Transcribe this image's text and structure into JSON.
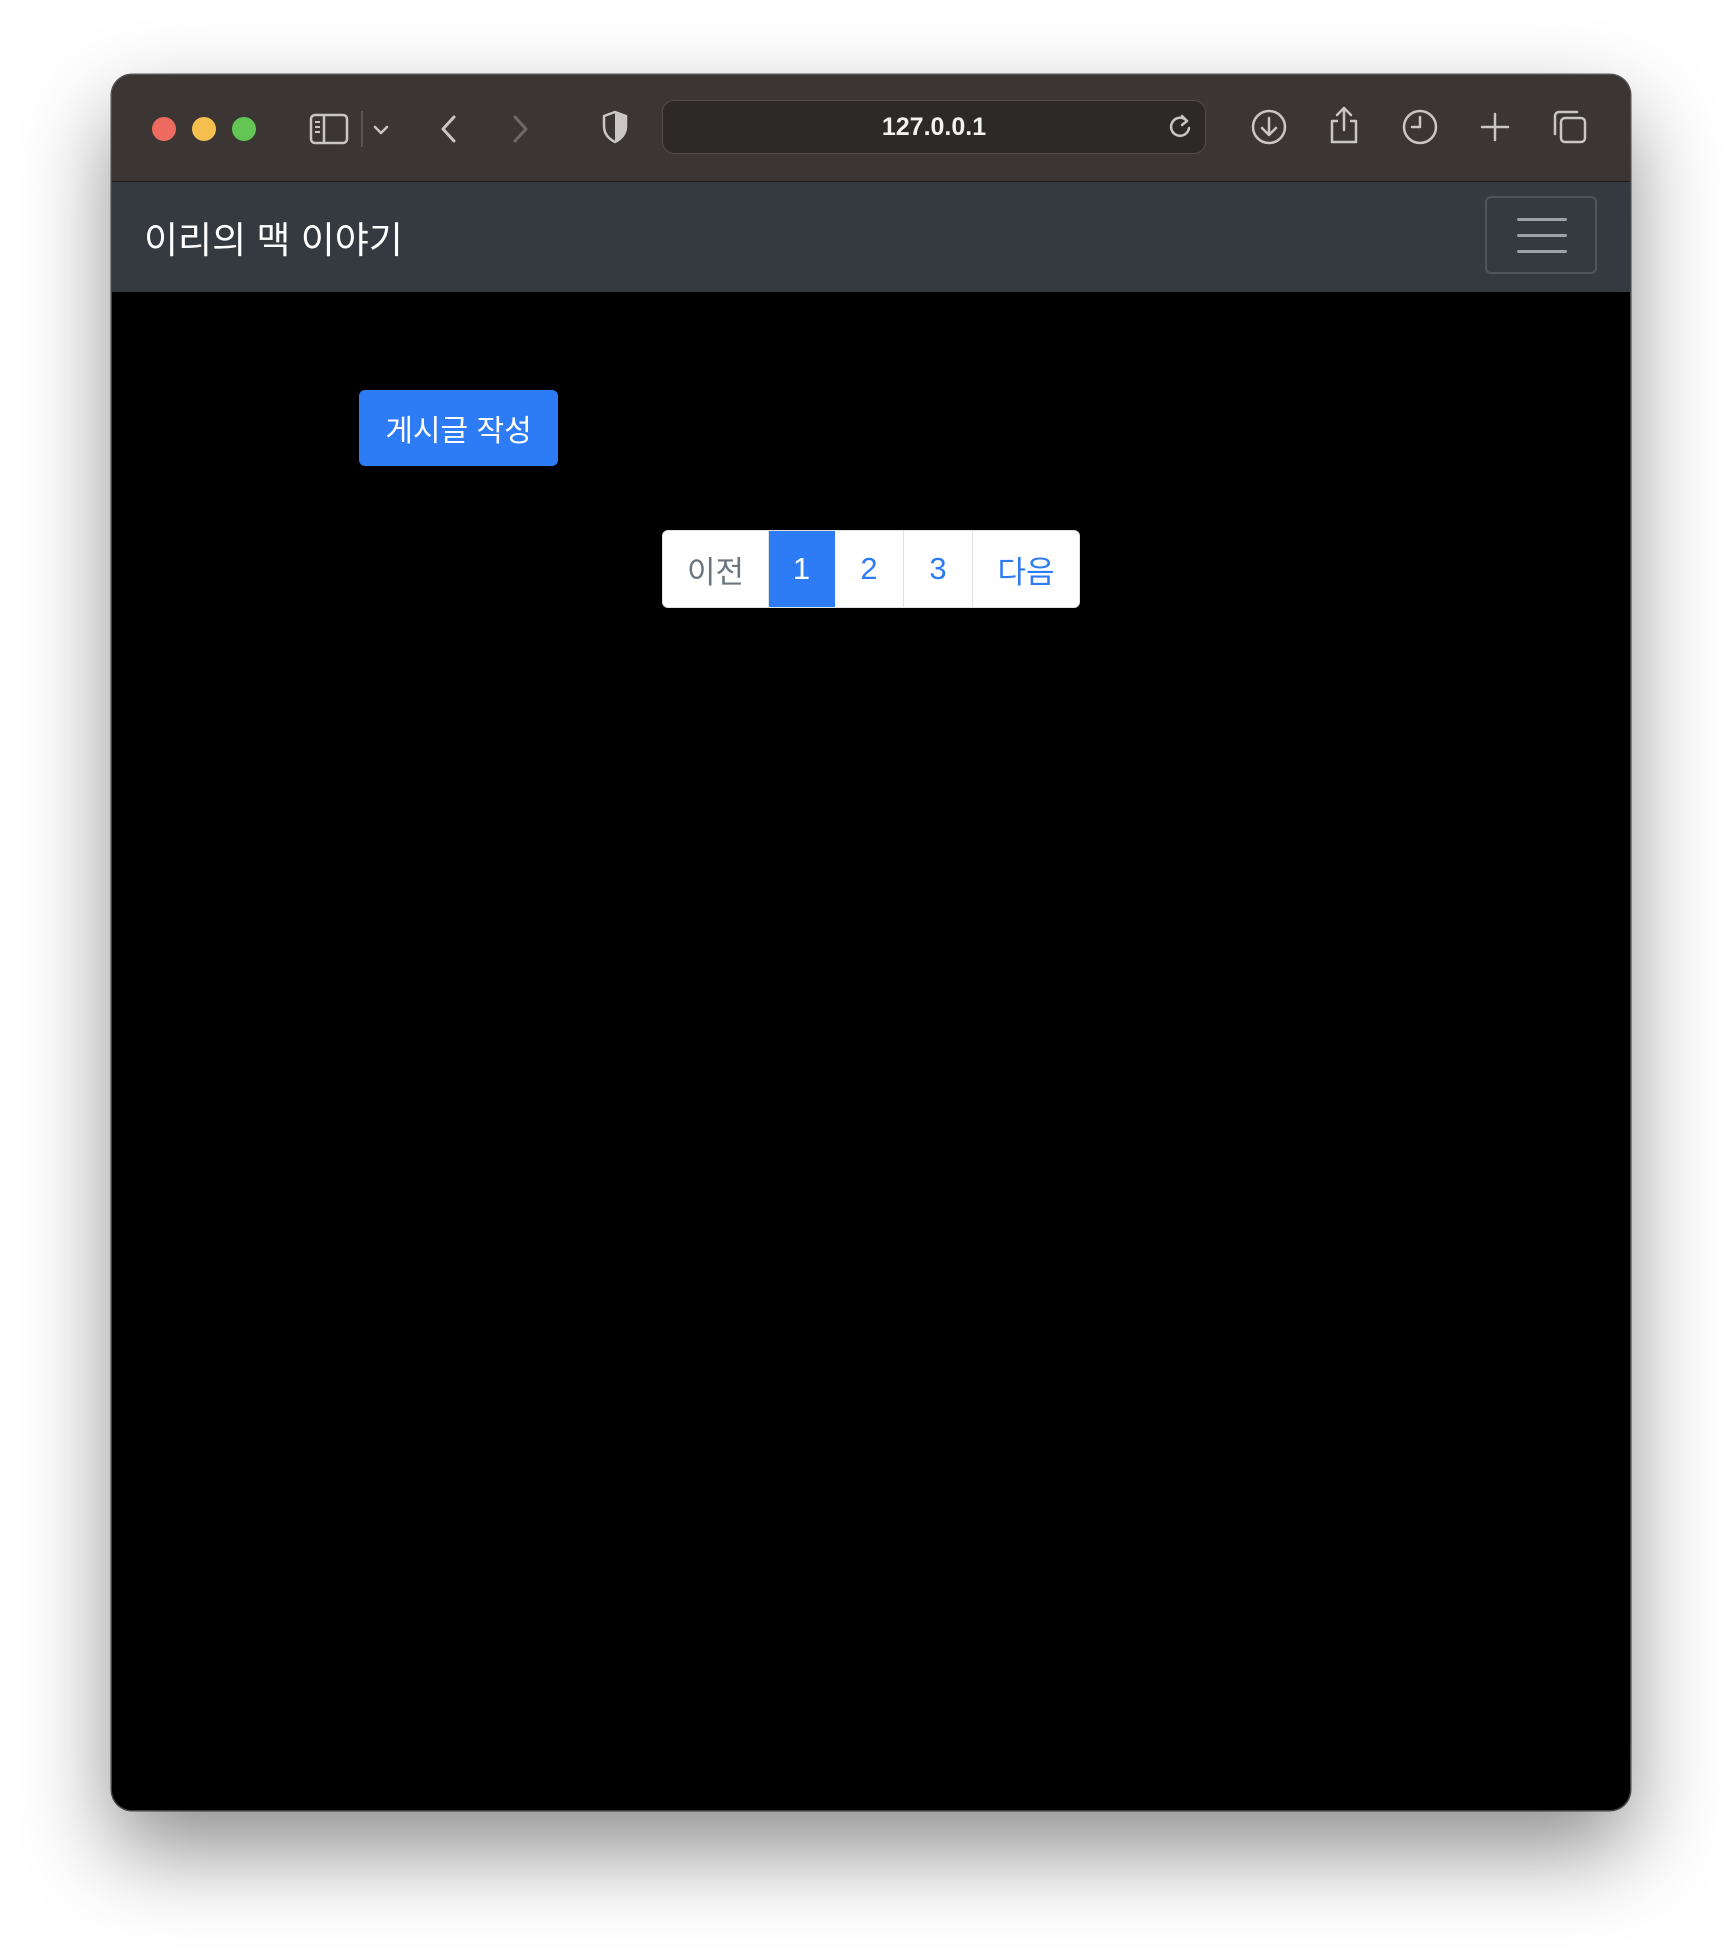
{
  "browser": {
    "address": "127.0.0.1"
  },
  "navbar": {
    "brand": "이리의 맥 이야기"
  },
  "main": {
    "write_button": "게시글 작성",
    "pagination": {
      "prev": "이전",
      "pages": [
        "1",
        "2",
        "3"
      ],
      "active_page": "1",
      "next": "다음"
    }
  },
  "colors": {
    "primary": "#2e7bf6",
    "navbar_bg": "#343a40",
    "toolbar_bg": "#3b3634",
    "page_bg": "#000000"
  }
}
